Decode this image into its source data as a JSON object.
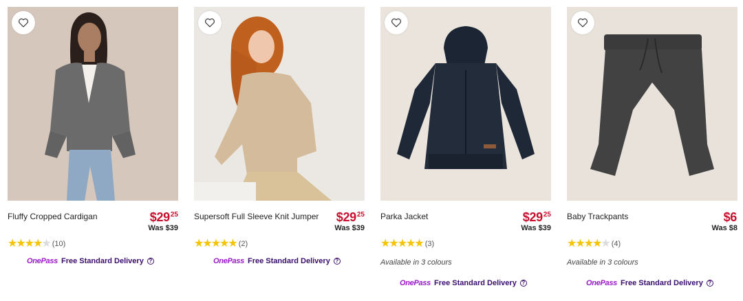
{
  "products": [
    {
      "name": "Fluffy Cropped Cardigan",
      "price_dollars": "$29",
      "price_cents": "25",
      "was": "Was $39",
      "rating": 4,
      "review_count": "(10)",
      "colours": "",
      "image": "woman in grey cardigan and jeans",
      "bg": "#d9c9c0"
    },
    {
      "name": "Supersoft Full Sleeve Knit Jumper",
      "price_dollars": "$29",
      "price_cents": "25",
      "was": "Was $39",
      "rating": 5,
      "review_count": "(2)",
      "colours": "",
      "image": "girl in beige knit jumper",
      "bg": "#ebe7e2"
    },
    {
      "name": "Parka Jacket",
      "price_dollars": "$29",
      "price_cents": "25",
      "was": "Was $39",
      "rating": 5,
      "review_count": "(3)",
      "colours": "Available in 3 colours",
      "image": "navy hooded parka jacket",
      "bg": "#e9e3dc"
    },
    {
      "name": "Baby Trackpants",
      "price_dollars": "$6",
      "price_cents": "",
      "was": "Was $8",
      "rating": 4,
      "review_count": "(4)",
      "colours": "Available in 3 colours",
      "image": "charcoal baby trackpants",
      "bg": "#e6e1db"
    }
  ],
  "delivery": {
    "onepass": "OnePass",
    "text": "Free Standard Delivery",
    "info": "?"
  }
}
